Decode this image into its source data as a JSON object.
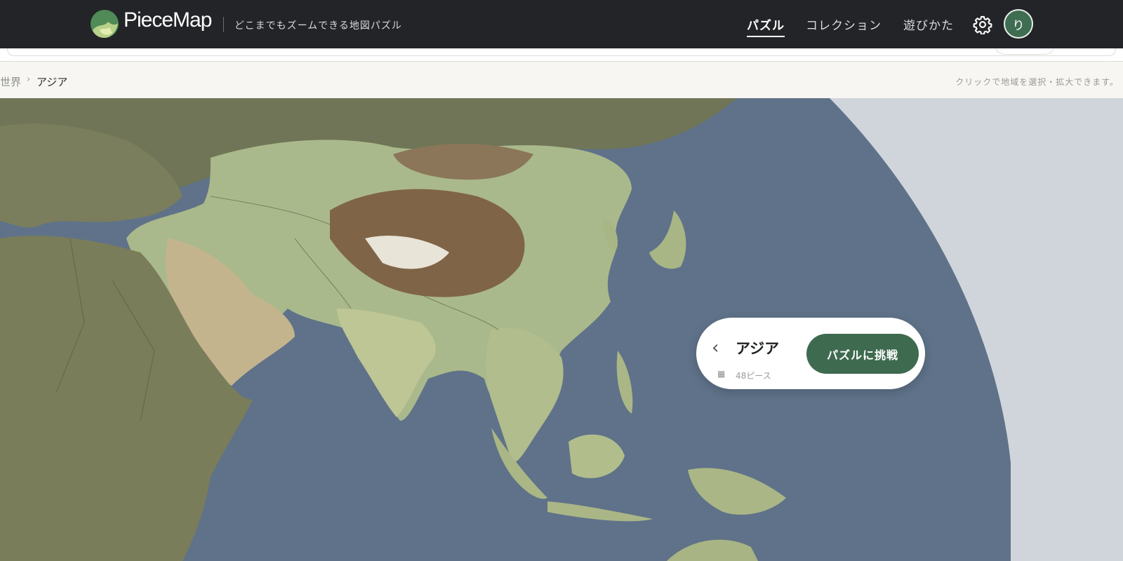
{
  "header": {
    "brand": "PieceMap",
    "tagline": "どこまでもズームできる地図パズル",
    "nav": [
      {
        "label": "パズル",
        "active": true
      },
      {
        "label": "コレクション",
        "active": false
      },
      {
        "label": "遊びかた",
        "active": false
      }
    ],
    "settings_icon": "gear-icon",
    "avatar_initial": "り"
  },
  "breadcrumb": {
    "items": [
      "世界",
      "アジア"
    ],
    "separator": "›",
    "hint": "クリックで地域を選択・拡大できます。"
  },
  "region_card": {
    "back_icon": "chevron-left-icon",
    "title": "アジア",
    "pieces_icon": "grid-icon",
    "pieces": "48ピース",
    "challenge_button": "パズルに挑戦"
  },
  "colors": {
    "header_bg": "#222427",
    "accent": "#3e6a4f",
    "ocean": "#5f7289",
    "land_green": "#a9b98a",
    "land_olive": "#7c7e5a",
    "mountain_brown": "#7a6148"
  }
}
